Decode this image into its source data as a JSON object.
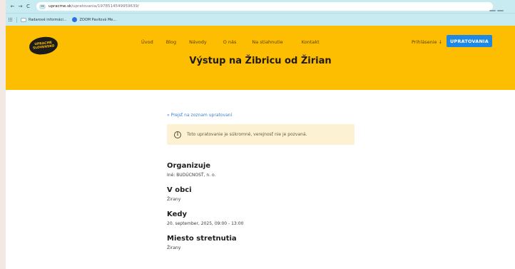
{
  "browser": {
    "nav": {
      "back": "←",
      "forward": "→",
      "reload": "C"
    },
    "url_host": "upracme.sk",
    "url_path": "/upratovania/1978514549959639/",
    "bookmarks": [
      "Radarové informáci...",
      "ZOOM Pavilová Me..."
    ]
  },
  "site": {
    "logo_lines": [
      "UPRACME",
      "SLOVENSKO"
    ],
    "menu": [
      "Úvod",
      "Blog",
      "Návody",
      "O nás",
      "Na stiahnutie",
      "Kontakt"
    ],
    "login_label": "Prihlásenie",
    "cta_label": "UPRATOVANIA"
  },
  "page": {
    "title": "Výstup na Žibricu od Žirian",
    "back_link": "« Prejsť na zoznam upratovaní",
    "notice": "Toto upratovanie je súkromné, verejnosť nie je pozvaná.",
    "details": [
      {
        "label": "Organizuje",
        "value": "Iné: BUDÚCNOSŤ, n. o."
      },
      {
        "label": "V obci",
        "value": "Žirany"
      },
      {
        "label": "Kedy",
        "value": "20. september, 2025, 09:00 - 13:00"
      },
      {
        "label": "Miesto stretnutia",
        "value": "Žirany"
      }
    ]
  },
  "colors": {
    "accent": "#fdbd00",
    "button": "#1e88e5",
    "link": "#3b7fd0",
    "notice_bg": "#fdf1d3",
    "chrome": "#c8ebf2"
  }
}
